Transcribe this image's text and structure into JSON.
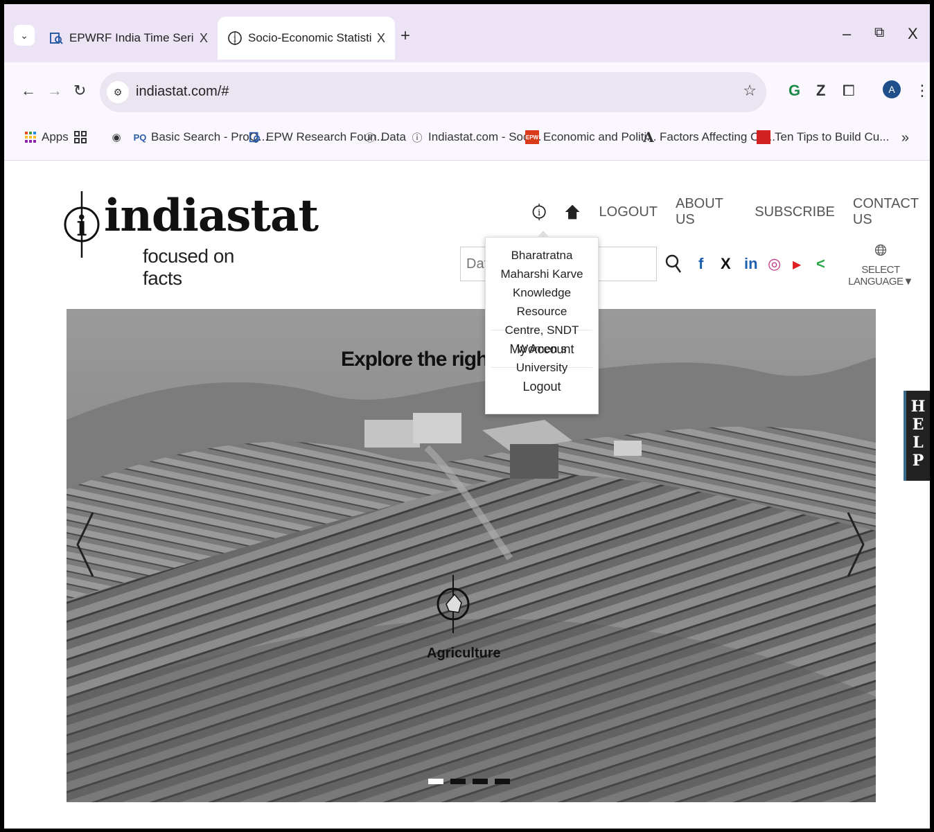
{
  "browser": {
    "tabs": [
      {
        "title": "EPWRF India Time Series",
        "active": false,
        "favicon": "search-doc-icon"
      },
      {
        "title": "Socio-Economic Statistics India,",
        "active": true,
        "favicon": "info-circle-icon"
      }
    ],
    "tab_close_glyph": "X",
    "new_tab_glyph": "+",
    "window_controls": {
      "minimize": "–",
      "restore": "⧉",
      "close": "X"
    },
    "url": "indiastat.com/#",
    "profile_initial": "A",
    "bookmarks": [
      {
        "label": "Apps",
        "icon": "apps-grid-icon"
      },
      {
        "label": "",
        "icon": "tab-groups-icon"
      },
      {
        "label": "",
        "icon": "globe-icon"
      },
      {
        "label": "Basic Search - ProQ...",
        "icon": "proquest-icon",
        "icon_text": "PQ"
      },
      {
        "label": "EPW Research Foun...",
        "icon": "search-doc-icon"
      },
      {
        "label": "Data",
        "icon": "info-circle-icon"
      },
      {
        "label": "Indiastat.com - Soci...",
        "icon": "info-circle-icon"
      },
      {
        "label": "Economic and Politi...",
        "icon": "epw-icon",
        "icon_text": "EPW"
      },
      {
        "label": "Factors Affecting Cu...",
        "icon": "letter-a-icon",
        "icon_text": "A"
      },
      {
        "label": "Ten Tips to Build Cu...",
        "icon": "red-badge-icon"
      }
    ],
    "bookmarks_more": "»"
  },
  "site": {
    "logo": {
      "word": "indiastat",
      "tagline": "focused on facts"
    },
    "nav": [
      "LOGOUT",
      "ABOUT US",
      "SUBSCRIBE",
      "CONTACT US"
    ],
    "search_placeholder": "Data",
    "social": [
      {
        "name": "facebook-icon",
        "glyph": "f",
        "color": "#1f5fb0"
      },
      {
        "name": "x-icon",
        "glyph": "X",
        "color": "#111111"
      },
      {
        "name": "linkedin-icon",
        "glyph": "in",
        "color": "#1f5fb0"
      },
      {
        "name": "instagram-icon",
        "glyph": "◎",
        "color": "#c13584"
      },
      {
        "name": "youtube-icon",
        "glyph": "▶",
        "color": "#e02020"
      },
      {
        "name": "share-icon",
        "glyph": "<",
        "color": "#2aa845"
      }
    ],
    "language_label": "SELECT LANGUAGE▼",
    "account_menu": {
      "organization": "Bharatratna Maharshi Karve Knowledge Resource Centre, SNDT Women s University",
      "items": [
        "My Account",
        "Logout"
      ]
    },
    "hero": {
      "title": "Explore the right per",
      "caption": "Agriculture",
      "slides": 4,
      "active_slide": 0
    },
    "help_label": [
      "H",
      "E",
      "L",
      "P"
    ]
  }
}
